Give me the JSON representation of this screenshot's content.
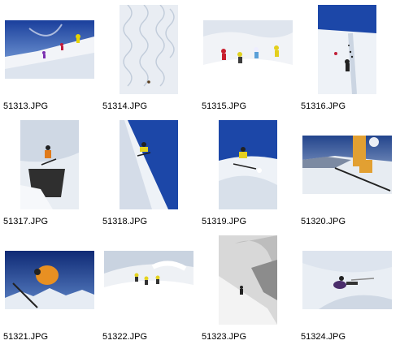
{
  "thumbnails": [
    {
      "filename": "51313.JPG",
      "scene": "skiers-on-slope-blue-sky"
    },
    {
      "filename": "51314.JPG",
      "scene": "ski-tracks-in-snow"
    },
    {
      "filename": "51315.JPG",
      "scene": "group-skiing-powder"
    },
    {
      "filename": "51316.JPG",
      "scene": "skiers-climbing-slope"
    },
    {
      "filename": "51317.JPG",
      "scene": "skier-jumping-cliff"
    },
    {
      "filename": "51318.JPG",
      "scene": "skier-on-steep-wall"
    },
    {
      "filename": "51319.JPG",
      "scene": "skier-spraying-powder"
    },
    {
      "filename": "51320.JPG",
      "scene": "skier-legs-sunset"
    },
    {
      "filename": "51321.JPG",
      "scene": "skier-jump-over-mountains"
    },
    {
      "filename": "51322.JPG",
      "scene": "skiers-traversing-ridge"
    },
    {
      "filename": "51323.JPG",
      "scene": "skier-in-whiteout"
    },
    {
      "filename": "51324.JPG",
      "scene": "skier-sitting-on-snow"
    }
  ],
  "colors": {
    "sky_blue": "#1c47a8",
    "snow": "#eef2f7",
    "snow_shadow": "#b9c6d6"
  }
}
